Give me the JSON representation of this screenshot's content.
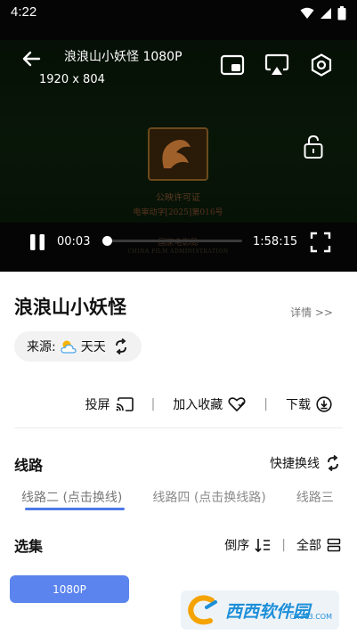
{
  "status_bar": {
    "time": "4:22",
    "icons": [
      "wifi-icon",
      "signal-icon",
      "battery-icon"
    ]
  },
  "player": {
    "title": "浪浪山小妖怪 1080P",
    "resolution": "1920 x 804",
    "current_time": "00:03",
    "duration": "1:58:15",
    "progress_fraction": 0.0004,
    "license_card": {
      "line1": "公映许可证",
      "line2": "电审动字[2025]第016号",
      "line3": "国家电影局",
      "line4": "CHINA FILM ADMINISTRATION"
    }
  },
  "detail": {
    "title": "浪浪山小妖怪",
    "detail_link": "详情 >>",
    "source_label": "来源:",
    "source_name": "天天"
  },
  "actions": {
    "cast": "投屏",
    "favorite": "加入收藏",
    "download": "下载"
  },
  "routes": {
    "section_title": "线路",
    "quick_switch": "快捷换线",
    "items": [
      "线路二 (点击换线)",
      "线路四 (点击换线路)",
      "线路三"
    ]
  },
  "episodes": {
    "section_title": "选集",
    "sort_label": "倒序",
    "all_label": "全部",
    "items": [
      "1080P"
    ]
  },
  "watermark": {
    "text": "西西软件园",
    "sub": "CR173.COM"
  },
  "colors": {
    "accent": "#5b84ee",
    "underline": "#4c78e8",
    "player_bg": "#050505"
  }
}
